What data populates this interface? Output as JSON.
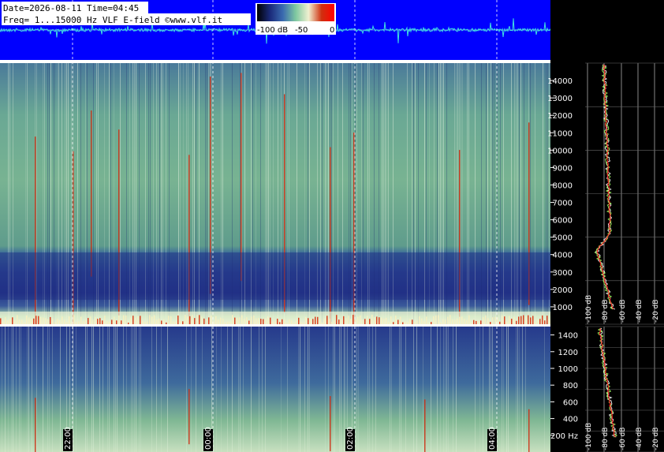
{
  "header": {
    "line1": "Date=2026-08-11 Time=04:45",
    "line2": "Freq= 1...15000 Hz   VLF E-field ©www.vlf.it"
  },
  "colorbar": {
    "labels": [
      "-100 dB",
      "-50",
      "0"
    ],
    "colors": [
      "#000000",
      "#1a2a7a",
      "#3a6ab0",
      "#7ec8a0",
      "#f0f0d0",
      "#d03010",
      "#ff0000"
    ]
  },
  "colors": {
    "waveform_bg": "#0000ff",
    "waveform_line": "#40e0e0",
    "spectrogram_low": "#22308a",
    "spectrogram_mid": "#5a9a8a",
    "spectrogram_high": "#cfe6c8",
    "red_line": "#d02a10",
    "spectrum_white": "#ffffff",
    "spectrum_green": "#a0ff60",
    "spectrum_red": "#ff2020"
  },
  "chart_data": [
    {
      "type": "line",
      "name": "waveform",
      "yticks": [
        "50 %",
        "0 %",
        "-50 %"
      ],
      "ylim": [
        -100,
        100
      ]
    },
    {
      "type": "heatmap",
      "name": "spectrogram-full",
      "yunit": "Hz",
      "ylim": [
        0,
        15000
      ],
      "yticks": [
        1000,
        2000,
        3000,
        4000,
        5000,
        6000,
        7000,
        8000,
        9000,
        10000,
        11000,
        12000,
        13000,
        14000
      ],
      "ytick_labels": [
        "1000",
        "2000",
        "3000",
        "4000",
        "5000",
        "6000",
        "7000",
        "8000",
        "9000",
        "10000",
        "11000",
        "12000",
        "13000",
        "14000"
      ],
      "spectrum_db_ticks": [
        "-100 dB",
        "-80 dB",
        "-60 dB",
        "-40 dB",
        "-20 dB"
      ]
    },
    {
      "type": "heatmap",
      "name": "spectrogram-low",
      "ylim": [
        0,
        1500
      ],
      "yticks": [
        200,
        400,
        600,
        800,
        1000,
        1200,
        1400
      ],
      "ytick_labels": [
        "200 Hz",
        "400",
        "600",
        "800",
        "1000",
        "1200",
        "1400"
      ],
      "xtick_labels": [
        "22:00",
        "00:00",
        "02:00",
        "04:00"
      ],
      "spectrum_db_ticks": [
        "-100 dB",
        "-80 dB",
        "-60 dB",
        "-40 dB",
        "-20 dB"
      ]
    }
  ]
}
